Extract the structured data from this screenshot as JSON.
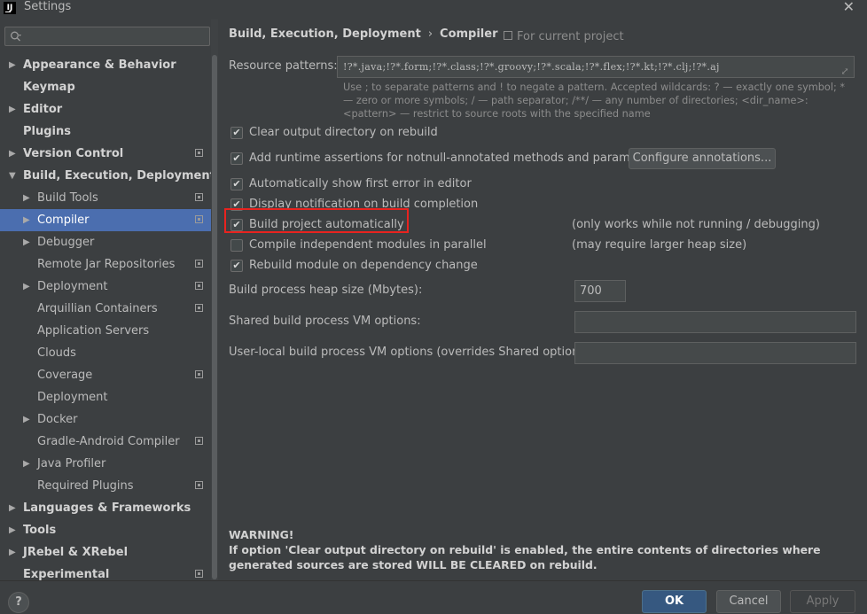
{
  "window": {
    "title": "Settings",
    "app_icon": "IJ"
  },
  "search": {
    "placeholder": ""
  },
  "tree": [
    {
      "label": "Appearance & Behavior",
      "bold": true,
      "arrow": true,
      "indent": 0,
      "proj": false
    },
    {
      "label": "Keymap",
      "bold": true,
      "arrow": false,
      "indent": 0,
      "proj": false
    },
    {
      "label": "Editor",
      "bold": true,
      "arrow": true,
      "indent": 0,
      "proj": false
    },
    {
      "label": "Plugins",
      "bold": true,
      "arrow": false,
      "indent": 0,
      "proj": false
    },
    {
      "label": "Version Control",
      "bold": true,
      "arrow": true,
      "indent": 0,
      "proj": true
    },
    {
      "label": "Build, Execution, Deployment",
      "bold": true,
      "arrow": true,
      "expanded": true,
      "indent": 0,
      "proj": false
    },
    {
      "label": "Build Tools",
      "bold": false,
      "arrow": true,
      "indent": 1,
      "proj": true
    },
    {
      "label": "Compiler",
      "bold": false,
      "arrow": true,
      "indent": 1,
      "proj": true,
      "selected": true
    },
    {
      "label": "Debugger",
      "bold": false,
      "arrow": true,
      "indent": 1,
      "proj": false
    },
    {
      "label": "Remote Jar Repositories",
      "bold": false,
      "arrow": false,
      "indent": 1,
      "proj": true
    },
    {
      "label": "Deployment",
      "bold": false,
      "arrow": true,
      "indent": 1,
      "proj": true
    },
    {
      "label": "Arquillian Containers",
      "bold": false,
      "arrow": false,
      "indent": 1,
      "proj": true
    },
    {
      "label": "Application Servers",
      "bold": false,
      "arrow": false,
      "indent": 1,
      "proj": false
    },
    {
      "label": "Clouds",
      "bold": false,
      "arrow": false,
      "indent": 1,
      "proj": false
    },
    {
      "label": "Coverage",
      "bold": false,
      "arrow": false,
      "indent": 1,
      "proj": true
    },
    {
      "label": "Deployment",
      "bold": false,
      "arrow": false,
      "indent": 1,
      "proj": false
    },
    {
      "label": "Docker",
      "bold": false,
      "arrow": true,
      "indent": 1,
      "proj": false
    },
    {
      "label": "Gradle-Android Compiler",
      "bold": false,
      "arrow": false,
      "indent": 1,
      "proj": true
    },
    {
      "label": "Java Profiler",
      "bold": false,
      "arrow": true,
      "indent": 1,
      "proj": false
    },
    {
      "label": "Required Plugins",
      "bold": false,
      "arrow": false,
      "indent": 1,
      "proj": true
    },
    {
      "label": "Languages & Frameworks",
      "bold": true,
      "arrow": true,
      "indent": 0,
      "proj": false
    },
    {
      "label": "Tools",
      "bold": true,
      "arrow": true,
      "indent": 0,
      "proj": false
    },
    {
      "label": "JRebel & XRebel",
      "bold": true,
      "arrow": true,
      "indent": 0,
      "proj": false
    },
    {
      "label": "Experimental",
      "bold": true,
      "arrow": false,
      "indent": 0,
      "proj": true
    }
  ],
  "header": {
    "crumb1": "Build, Execution, Deployment",
    "crumb_sep": "›",
    "crumb2": "Compiler",
    "for_project": "For current project"
  },
  "resource": {
    "label": "Resource patterns:",
    "value": "!?*.java;!?*.form;!?*.class;!?*.groovy;!?*.scala;!?*.flex;!?*.kt;!?*.clj;!?*.aj",
    "hint": "Use ; to separate patterns and ! to negate a pattern. Accepted wildcards: ? — exactly one symbol; * — zero or more symbols; / — path separator; /**/ — any number of directories; <dir_name>:<pattern> — restrict to source roots with the specified name"
  },
  "options": {
    "clear_output": {
      "label": "Clear output directory on rebuild",
      "checked": true
    },
    "runtime_assertions": {
      "label": "Add runtime assertions for notnull-annotated methods and parameters",
      "checked": true
    },
    "configure_annotations": "Configure annotations...",
    "show_first_error": {
      "label": "Automatically show first error in editor",
      "checked": true
    },
    "display_notification": {
      "label": "Display notification on build completion",
      "checked": true
    },
    "build_auto": {
      "label": "Build project automatically",
      "checked": true,
      "note": "(only works while not running / debugging)"
    },
    "compile_parallel": {
      "label": "Compile independent modules in parallel",
      "checked": false,
      "note": "(may require larger heap size)"
    },
    "rebuild_dependency": {
      "label": "Rebuild module on dependency change",
      "checked": true
    }
  },
  "fields": {
    "heap_label": "Build process heap size (Mbytes):",
    "heap_value": "700",
    "shared_vm_label": "Shared build process VM options:",
    "shared_vm_value": "",
    "user_vm_label": "User-local build process VM options (overrides Shared options):",
    "user_vm_value": ""
  },
  "warning": {
    "title": "WARNING!",
    "body": "If option 'Clear output directory on rebuild' is enabled, the entire contents of directories where generated sources are stored WILL BE CLEARED on rebuild."
  },
  "footer": {
    "help": "?",
    "ok": "OK",
    "cancel": "Cancel",
    "apply": "Apply"
  },
  "colors": {
    "background": "#3c3f41",
    "selection": "#4b6eaf",
    "ok_button": "#365880",
    "highlight_box": "#e8231f"
  }
}
